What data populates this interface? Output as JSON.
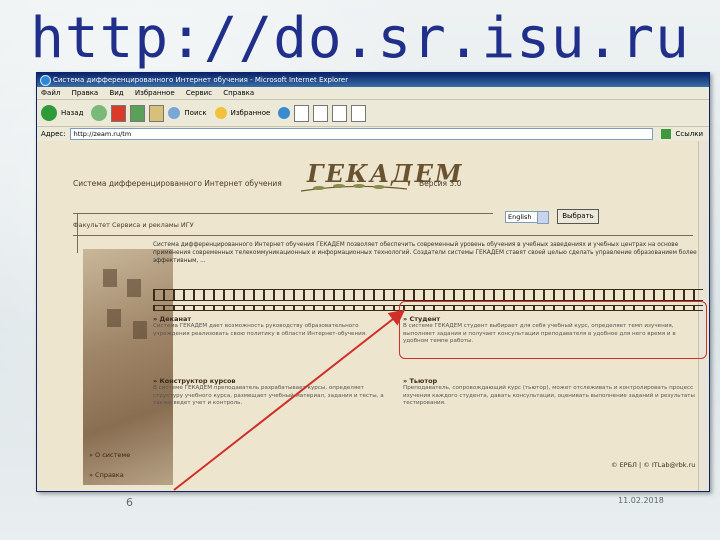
{
  "slide": {
    "title": "http://do.sr.isu.ru",
    "number": "6",
    "date": "11.02.2018"
  },
  "browser": {
    "window_title": "Система дифференцированного Интернет обучения - Microsoft Internet Explorer",
    "menu": [
      "Файл",
      "Правка",
      "Вид",
      "Избранное",
      "Сервис",
      "Справка"
    ],
    "toolbar": {
      "back": "Назад",
      "search": "Поиск",
      "favorites": "Избранное"
    },
    "address_label": "Адрес:",
    "address_value": "http://zeam.ru/tm",
    "links_label": "Ссылки"
  },
  "page": {
    "system_name": "Система дифференцированного Интернет обучения",
    "logo_text": "ГЕКАДЕМ",
    "version": "Версия 3.0",
    "language_value": "English",
    "choose_button": "Выбрать",
    "faculty": "Факультет Сервиса и рекламы ИГУ",
    "intro": "Система дифференцированного Интернет обучения ГЕКАДЕМ позволяет обеспечить современный уровень обучения в учебных заведениях и учебных центрах на основе применения современных телекоммуникационных и информационных технологий. Создатели системы ГЕКАДЕМ ставят своей целью сделать управление образованием более эффективным, ...",
    "sections": [
      {
        "title": "» Деканат",
        "text": "Система ГЕКАДЕМ дает возможность руководству образовательного учреждения реализовать свою политику в области Интернет-обучения."
      },
      {
        "title": "» Студент",
        "text": "В системе ГЕКАДЕМ студент выбирает для себя учебный курс, определяет темп изучения, выполняет задания и получает консультации преподавателя в удобное для него время и в удобном темпе работы."
      },
      {
        "title": "» Конструктор курсов",
        "text": "В системе ГЕКАДЕМ преподаватель разрабатывает курсы, определяет структуру учебного курса, размещает учебный материал, задания и тесты, а также ведет учет и контроль."
      },
      {
        "title": "» Тьютор",
        "text": "Преподаватель, сопровождающий курс (тьютор), может отслеживать и контролировать процесс изучения каждого студента, давать консультации, оценивать выполнение заданий и результаты тестирования."
      }
    ],
    "nav": [
      "» О системе",
      "» Справка"
    ],
    "footer": "© ЕРБЛ | © ITLab@rbk.ru"
  }
}
